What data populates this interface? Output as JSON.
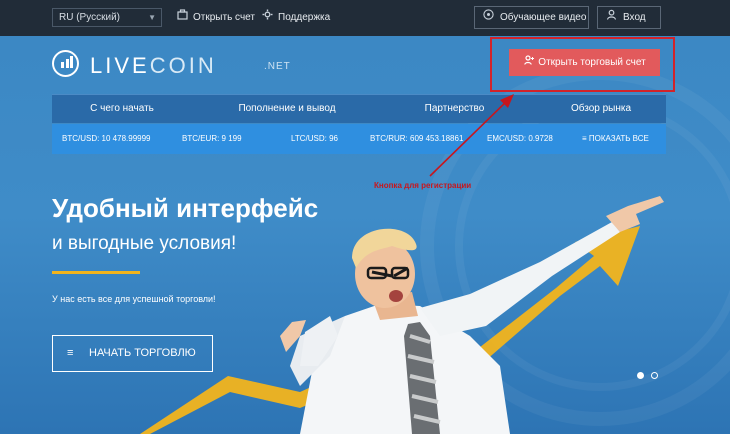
{
  "topbar": {
    "language": "RU (Русский)",
    "open_account": "Открыть счет",
    "support": "Поддержка",
    "tutorial_video": "Обучающее видео",
    "login": "Вход"
  },
  "logo": {
    "text_bold": "LIVE",
    "text_light": "COIN",
    "suffix": ".NET"
  },
  "cta": {
    "open_trading_account": "Открыть торговый счет"
  },
  "nav": {
    "items": [
      {
        "label": "С чего начать"
      },
      {
        "label": "Пополнение и вывод"
      },
      {
        "label": "Партнерство"
      },
      {
        "label": "Обзор рынка"
      }
    ]
  },
  "ticker": {
    "items": [
      {
        "label": "BTC/USD: 10 478.99999"
      },
      {
        "label": "BTC/EUR: 9 199"
      },
      {
        "label": "LTC/USD: 96"
      },
      {
        "label": "BTC/RUR: 609 453.18861"
      },
      {
        "label": "EMC/USD: 0.9728"
      }
    ],
    "show_all": "ПОКАЗАТЬ ВСЕ"
  },
  "annotation": {
    "text": "Кнопка для регистрации",
    "color": "#c8161d"
  },
  "hero": {
    "title": "Удобный интерфейс",
    "subtitle": "и выгодные условия!",
    "tagline": "У нас есть все для успешной торговли!",
    "start_button": "НАЧАТЬ ТОРГОВЛЮ"
  },
  "slider": {
    "total": 2,
    "active_index": 0
  },
  "colors": {
    "accent_red": "#e25a5c",
    "accent_yellow": "#f2b41c",
    "hero_blue": "#3c88c4",
    "topbar": "#212c38"
  },
  "icons": {
    "open_account": "briefcase-icon",
    "support": "gear-icon",
    "tutorial_video": "play-circle-icon",
    "login": "user-icon",
    "cta": "user-plus-icon",
    "show_all": "menu-icon",
    "start": "menu-icon"
  }
}
